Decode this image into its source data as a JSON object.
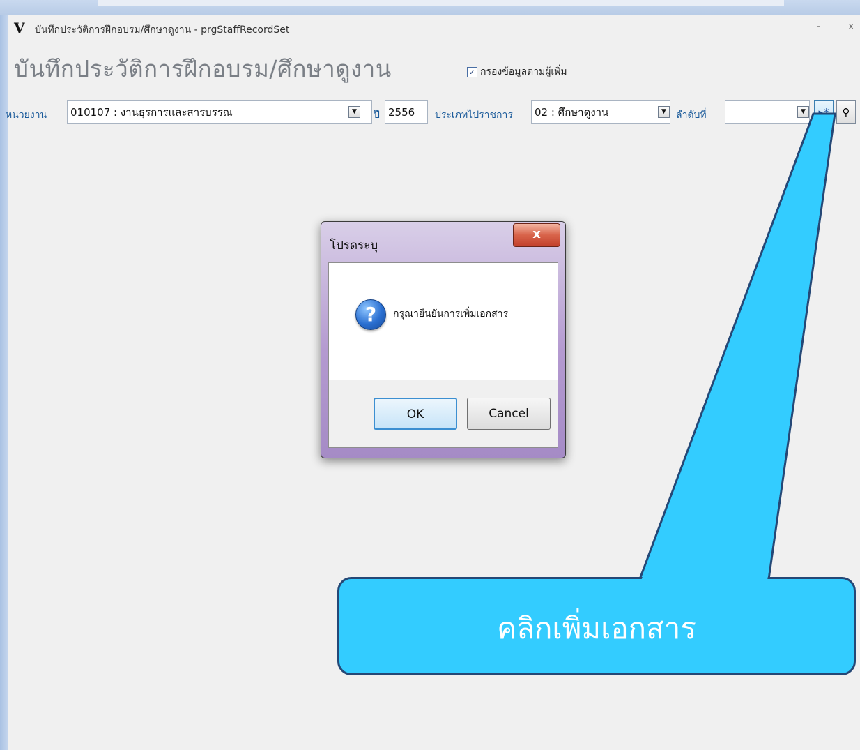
{
  "window": {
    "icon_glyph": "V",
    "title": "บันทึกประวัติการฝึกอบรม/ศึกษาดูงาน - prgStaffRecordSet",
    "minimize": "-",
    "close": "x"
  },
  "form": {
    "heading": "บันทึกประวัติการฝึกอบรม/ศึกษาดูงาน",
    "filter_checked": "✓",
    "filter_label": "กรองข้อมูลตามผู้เพิ่ม",
    "unit_label": "หน่วยงาน",
    "unit_value": "010107 : งานธุรการและสารบรรณ",
    "year_label": "ปี",
    "year_value": "2556",
    "type_label": "ประเภทไปราชการ",
    "type_value": "02 : ศึกษาดูงาน",
    "seq_label": "ลำดับที่",
    "seq_value": "",
    "dropdown_glyph": "▼",
    "new_record_glyph": "▸*",
    "search_glyph": "⚲"
  },
  "dialog": {
    "title": "โปรดระบุ",
    "close": "x",
    "icon_glyph": "?",
    "message": "กรุณายืนยันการเพิ่มเอกสาร",
    "ok_label": "OK",
    "cancel_label": "Cancel"
  },
  "callout": {
    "text": "คลิกเพิ่มเอกสาร",
    "color": "#33ccff"
  }
}
